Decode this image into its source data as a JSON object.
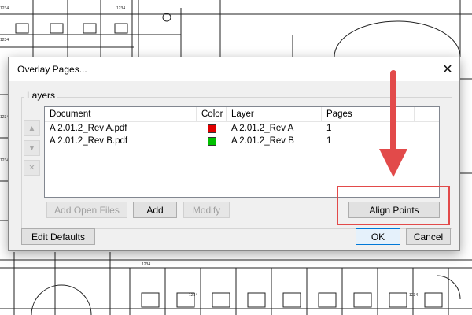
{
  "dialog": {
    "title": "Overlay Pages...",
    "close_glyph": "✕"
  },
  "layers_group": {
    "label": "Layers",
    "columns": [
      "Document",
      "Color",
      "Layer",
      "Pages"
    ],
    "rows": [
      {
        "document": "A 2.01.2_Rev A.pdf",
        "color": "#e00000",
        "layer": "A 2.01.2_Rev A",
        "pages": "1"
      },
      {
        "document": "A 2.01.2_Rev B.pdf",
        "color": "#00c000",
        "layer": "A 2.01.2_Rev B",
        "pages": "1"
      }
    ],
    "reorder": {
      "up_glyph": "▲",
      "down_glyph": "▼",
      "delete_glyph": "✕"
    },
    "buttons": {
      "add_open_files": "Add Open Files",
      "add": "Add",
      "modify": "Modify",
      "align_points": "Align Points"
    }
  },
  "footer": {
    "edit_defaults": "Edit Defaults",
    "ok": "OK",
    "cancel": "Cancel"
  },
  "annotation": {
    "color": "#e24a4a",
    "icons": [
      "down-arrow-icon"
    ]
  },
  "blueprint_labels": [
    "1234",
    "1234",
    "1234",
    "1234",
    "1234",
    "1234",
    "1234",
    "1234"
  ]
}
